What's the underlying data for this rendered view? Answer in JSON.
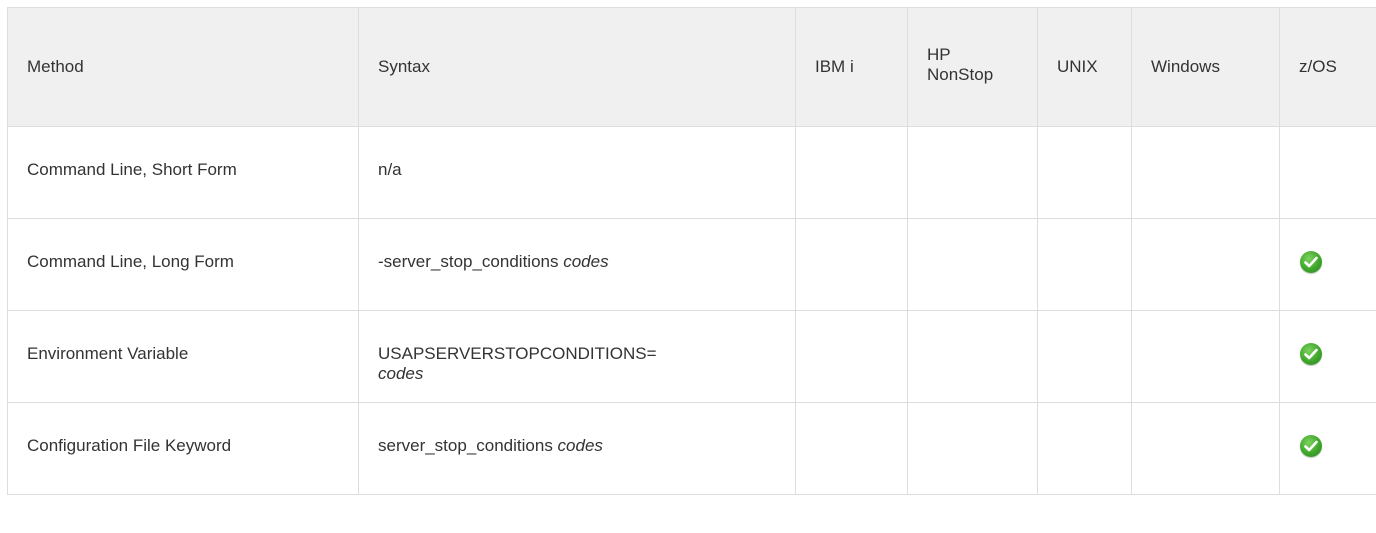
{
  "headers": {
    "method": "Method",
    "syntax": "Syntax",
    "ibmi": "IBM i",
    "hp_line1": "HP",
    "hp_line2": "NonStop",
    "unix": "UNIX",
    "windows": "Windows",
    "zos": "z/OS"
  },
  "rows": [
    {
      "method": "Command Line, Short Form",
      "syntax_plain": "n/a",
      "syntax_italic": "",
      "zos_supported": false
    },
    {
      "method": "Command Line, Long Form",
      "syntax_plain": "-server_stop_conditions ",
      "syntax_italic": "codes",
      "zos_supported": true
    },
    {
      "method": "Environment Variable",
      "syntax_plain": "USAPSERVERSTOPCONDITIONS=",
      "syntax_italic": "codes",
      "zos_supported": true
    },
    {
      "method": "Configuration File Keyword",
      "syntax_plain": "server_stop_conditions ",
      "syntax_italic": "codes",
      "zos_supported": true
    }
  ],
  "icons": {
    "supported": "check-circle-icon",
    "check_color": "#3fa52b"
  }
}
